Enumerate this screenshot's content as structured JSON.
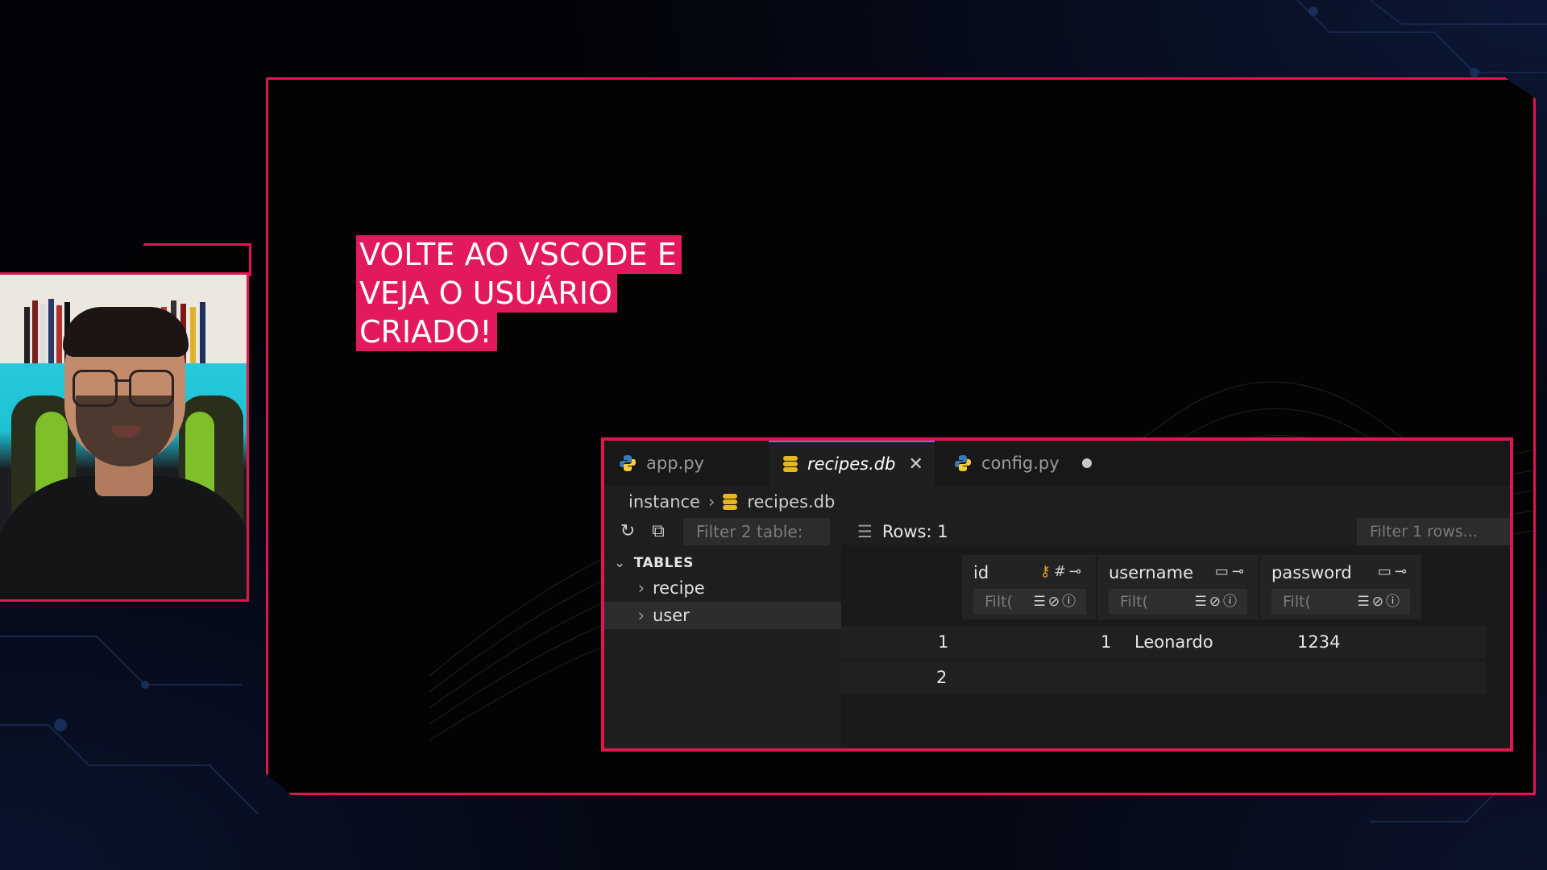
{
  "caption": {
    "line1": "VOLTE AO VSCODE E",
    "line2": "VEJA O USUÁRIO",
    "line3": "CRIADO!"
  },
  "editor": {
    "tabs": [
      {
        "label": "app.py",
        "icon": "python-icon"
      },
      {
        "label": "recipes.db",
        "icon": "database-icon",
        "close": "✕"
      },
      {
        "label": "config.py",
        "icon": "python-icon",
        "modified": "●"
      }
    ],
    "breadcrumb": {
      "folder": "instance",
      "separator": "›",
      "file": "recipes.db"
    },
    "sidebar": {
      "filter_placeholder": "Filter 2 table:",
      "section_title": "TABLES",
      "tables": [
        "recipe",
        "user"
      ]
    },
    "grid": {
      "rows_label": "Rows: 1",
      "filter_placeholder": "Filter 1 rows...",
      "columns": [
        {
          "name": "id",
          "icons": "#⊸",
          "filter": "Filt("
        },
        {
          "name": "username",
          "icons": "▭⊸",
          "filter": "Filt("
        },
        {
          "name": "password",
          "icons": "▭⊸",
          "filter": "Filt("
        }
      ],
      "rows": [
        {
          "num": "1",
          "id": "1",
          "username": "Leonardo",
          "password": "1234"
        },
        {
          "num": "2",
          "id": "",
          "username": "",
          "password": ""
        }
      ]
    }
  },
  "colors": {
    "accent": "#e2154f",
    "caption_bg": "#e2195a",
    "db_icon": "#e5b820"
  }
}
